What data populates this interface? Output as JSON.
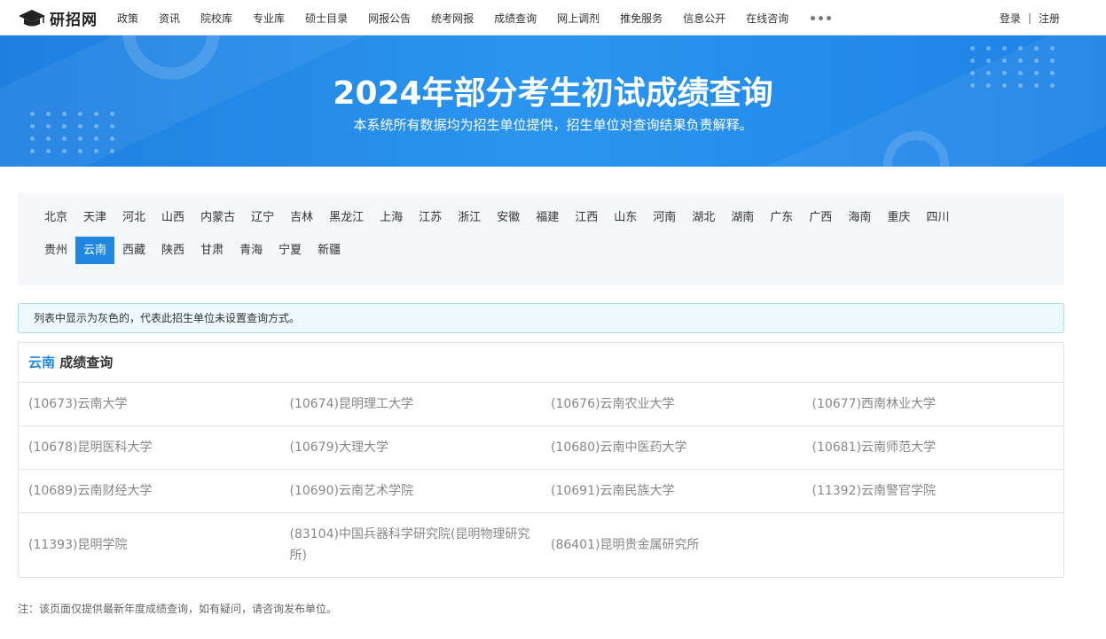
{
  "header": {
    "logo_text": "研招网",
    "nav": [
      "政策",
      "资讯",
      "院校库",
      "专业库",
      "硕士目录",
      "网报公告",
      "统考网报",
      "成绩查询",
      "网上调剂",
      "推免服务",
      "信息公开",
      "在线咨询"
    ],
    "login": "登录",
    "divider": "|",
    "register": "注册"
  },
  "banner": {
    "title": "2024年部分考生初试成绩查询",
    "subtitle": "本系统所有数据均为招生单位提供，招生单位对查询结果负责解释。"
  },
  "provinces": {
    "row1": [
      "北京",
      "天津",
      "河北",
      "山西",
      "内蒙古",
      "辽宁",
      "吉林",
      "黑龙江",
      "上海",
      "江苏",
      "浙江",
      "安徽",
      "福建",
      "江西",
      "山东",
      "河南",
      "湖北",
      "湖南",
      "广东",
      "广西",
      "海南",
      "重庆",
      "四川"
    ],
    "row2": [
      "贵州",
      "云南",
      "西藏",
      "陕西",
      "甘肃",
      "青海",
      "宁夏",
      "新疆"
    ],
    "selected": "云南"
  },
  "notice": "列表中显示为灰色的，代表此招生单位未设置查询方式。",
  "results": {
    "province": "云南",
    "heading_suffix": "成绩查询",
    "rows": [
      [
        "(10673)云南大学",
        "(10674)昆明理工大学",
        "(10676)云南农业大学",
        "(10677)西南林业大学"
      ],
      [
        "(10678)昆明医科大学",
        "(10679)大理大学",
        "(10680)云南中医药大学",
        "(10681)云南师范大学"
      ],
      [
        "(10689)云南财经大学",
        "(10690)云南艺术学院",
        "(10691)云南民族大学",
        "(11392)云南警官学院"
      ],
      [
        "(11393)昆明学院",
        "(83104)中国兵器科学研究院(昆明物理研究所)",
        "(86401)昆明贵金属研究所",
        ""
      ]
    ]
  },
  "footnote": "注：该页面仅提供最新年度成绩查询，如有疑问，请咨询发布单位。",
  "colors": {
    "accent": "#1f87e0",
    "banner": "#2a95f0",
    "notice_bg": "#eef8ff",
    "muted_text": "#888888"
  }
}
